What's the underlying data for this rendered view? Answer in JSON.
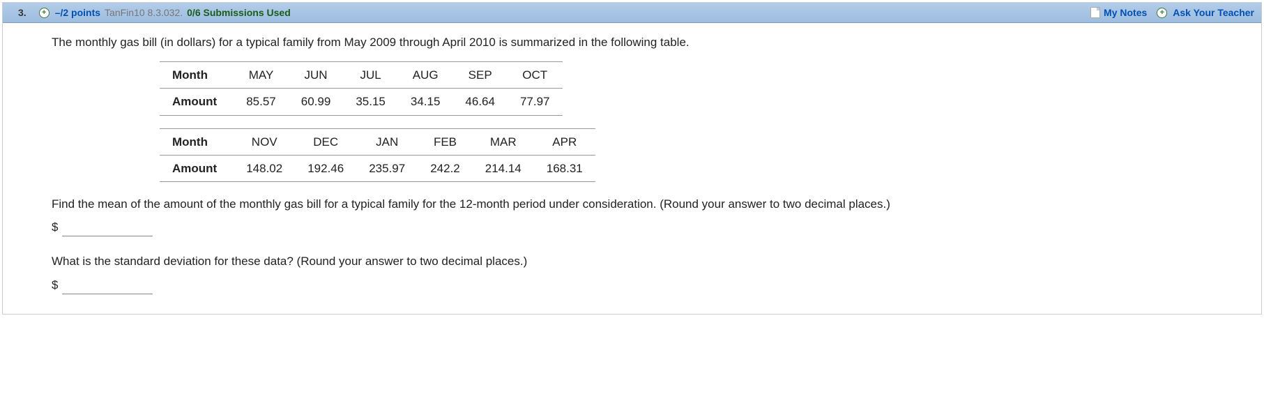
{
  "header": {
    "question_number": "3.",
    "points": "–/2 points",
    "reference": "TanFin10 8.3.032.",
    "submissions": "0/6 Submissions Used",
    "my_notes": "My Notes",
    "ask_teacher": "Ask Your Teacher"
  },
  "body": {
    "intro": "The monthly gas bill (in dollars) for a typical family from May 2009 through April 2010 is summarized in the following table.",
    "table1": {
      "row_header1": "Month",
      "row_header2": "Amount",
      "months": [
        "MAY",
        "JUN",
        "JUL",
        "AUG",
        "SEP",
        "OCT"
      ],
      "amounts": [
        "85.57",
        "60.99",
        "35.15",
        "34.15",
        "46.64",
        "77.97"
      ]
    },
    "table2": {
      "row_header1": "Month",
      "row_header2": "Amount",
      "months": [
        "NOV",
        "DEC",
        "JAN",
        "FEB",
        "MAR",
        "APR"
      ],
      "amounts": [
        "148.02",
        "192.46",
        "235.97",
        "242.2",
        "214.14",
        "168.31"
      ]
    },
    "q1": "Find the mean of the amount of the monthly gas bill for a typical family for the 12-month period under consideration. (Round your answer to two decimal places.)",
    "q2": "What is the standard deviation for these data? (Round your answer to two decimal places.)",
    "currency": "$"
  }
}
